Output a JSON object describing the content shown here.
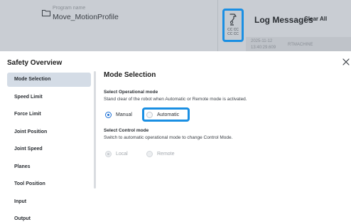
{
  "program": {
    "caption": "Program name",
    "name": "Move_MotionProfile"
  },
  "robot_button": {
    "code_line1": "CC CC",
    "code_line2": "CC CC"
  },
  "log": {
    "title": "Log Messages",
    "clear_label": "Clear All",
    "entry": {
      "date": "2025-11-12",
      "time": "13:40:29.609",
      "source": "RTMACHINE"
    }
  },
  "modal": {
    "title": "Safety Overview",
    "close_icon": "close-icon"
  },
  "sidebar": {
    "items": [
      {
        "label": "Mode Selection",
        "active": true
      },
      {
        "label": "Speed Limit"
      },
      {
        "label": "Force Limit"
      },
      {
        "label": "Joint Position"
      },
      {
        "label": "Joint Speed"
      },
      {
        "label": "Planes"
      },
      {
        "label": "Tool Position"
      },
      {
        "label": "Input"
      },
      {
        "label": "Output"
      }
    ]
  },
  "content": {
    "title": "Mode Selection",
    "operational": {
      "label": "Select Operational mode",
      "description": "Stand clear of the robot when Automatic or Remote mode is activated.",
      "options": [
        {
          "label": "Manual",
          "selected": true
        },
        {
          "label": "Automatic",
          "selected": false
        }
      ]
    },
    "control": {
      "label": "Select Control mode",
      "description": "Switch to automatic operational mode to change Control Mode.",
      "options": [
        {
          "label": "Local",
          "selected": true,
          "disabled": true
        },
        {
          "label": "Remote",
          "selected": false,
          "disabled": true
        }
      ]
    }
  },
  "colors": {
    "accent": "#1a8fe3",
    "radio_on": "#1a6fd6",
    "active_item_bg": "#d4dce6"
  }
}
